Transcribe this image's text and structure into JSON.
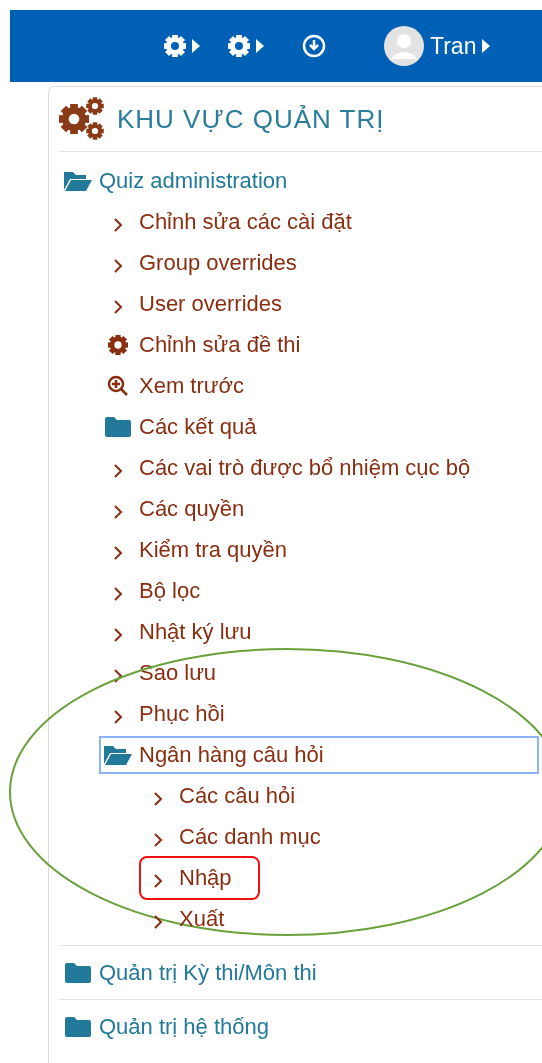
{
  "topbar": {
    "user_name": "Tran"
  },
  "panel": {
    "title": "KHU VỰC QUẢN TRỊ",
    "tree": [
      {
        "label": "Quiz administration",
        "kind": "folder",
        "expanded": true,
        "focused": false,
        "children": [
          {
            "label": "Chỉnh sửa các cài đặt",
            "kind": "link",
            "focused": false
          },
          {
            "label": "Group overrides",
            "kind": "link",
            "focused": false
          },
          {
            "label": "User overrides",
            "kind": "link",
            "focused": false
          },
          {
            "label": "Chỉnh sửa đề thi",
            "kind": "gear",
            "focused": false
          },
          {
            "label": "Xem trước",
            "kind": "preview",
            "focused": false
          },
          {
            "label": "Các kết quả",
            "kind": "folder",
            "expanded": false,
            "focused": false
          },
          {
            "label": "Các vai trò được bổ nhiệm cục bộ",
            "kind": "link",
            "focused": false
          },
          {
            "label": "Các quyền",
            "kind": "link",
            "focused": false
          },
          {
            "label": "Kiểm tra quyền",
            "kind": "link",
            "focused": false
          },
          {
            "label": "Bộ lọc",
            "kind": "link",
            "focused": false
          },
          {
            "label": "Nhật ký lưu",
            "kind": "link",
            "focused": false
          },
          {
            "label": "Sao lưu",
            "kind": "link",
            "focused": false
          },
          {
            "label": "Phục hồi",
            "kind": "link",
            "focused": false
          },
          {
            "label": "Ngân hàng câu hỏi",
            "kind": "folder",
            "expanded": true,
            "focused": true,
            "circled": true,
            "children": [
              {
                "label": "Các câu hỏi",
                "kind": "link",
                "focused": false
              },
              {
                "label": "Các danh mục",
                "kind": "link",
                "focused": false
              },
              {
                "label": "Nhập",
                "kind": "link",
                "focused": false,
                "boxed": true
              },
              {
                "label": "Xuất",
                "kind": "link",
                "focused": false
              }
            ]
          }
        ]
      },
      {
        "label": "Quản trị Kỳ thi/Môn thi",
        "kind": "folder",
        "expanded": false,
        "focused": false
      },
      {
        "label": "Quản trị hệ thống",
        "kind": "folder",
        "expanded": false,
        "focused": false
      }
    ]
  }
}
